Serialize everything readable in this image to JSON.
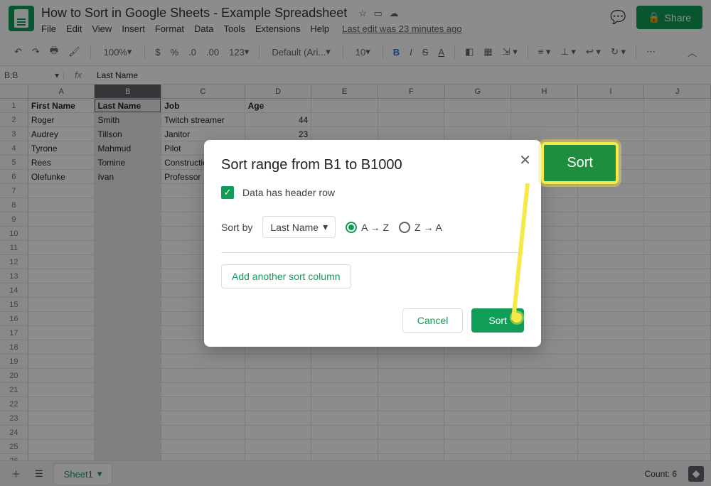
{
  "doc": {
    "title": "How to Sort in Google Sheets - Example Spreadsheet"
  },
  "menu": {
    "file": "File",
    "edit": "Edit",
    "view": "View",
    "insert": "Insert",
    "format": "Format",
    "data": "Data",
    "tools": "Tools",
    "extensions": "Extensions",
    "help": "Help",
    "last_edit": "Last edit was 23 minutes ago"
  },
  "share": {
    "label": "Share"
  },
  "toolbar": {
    "zoom": "100%",
    "font": "Default (Ari...",
    "size": "10",
    "format_num": "123"
  },
  "namebox": {
    "ref": "B:B",
    "formula": "Last Name"
  },
  "columns": [
    "A",
    "B",
    "C",
    "D",
    "E",
    "F",
    "G",
    "H",
    "I",
    "J"
  ],
  "headers": {
    "A": "First Name",
    "B": "Last Name",
    "C": "Job",
    "D": "Age"
  },
  "rows": [
    {
      "A": "Roger",
      "B": "Smith",
      "C": "Twitch streamer",
      "D": "44"
    },
    {
      "A": "Audrey",
      "B": "Tillson",
      "C": "Janitor",
      "D": "23"
    },
    {
      "A": "Tyrone",
      "B": "Mahmud",
      "C": "Pilot",
      "D": ""
    },
    {
      "A": "Rees",
      "B": "Tomine",
      "C": "Construction",
      "D": ""
    },
    {
      "A": "Olefunke",
      "B": "Ivan",
      "C": "Professor",
      "D": ""
    }
  ],
  "dialog": {
    "title": "Sort range from B1 to B1000",
    "header_row": "Data has header row",
    "sort_by": "Sort by",
    "column": "Last Name",
    "az": "A → Z",
    "za": "Z → A",
    "add": "Add another sort column",
    "cancel": "Cancel",
    "sort": "Sort"
  },
  "callout": {
    "sort": "Sort"
  },
  "tabs": {
    "sheet1": "Sheet1",
    "count": "Count: 6"
  }
}
